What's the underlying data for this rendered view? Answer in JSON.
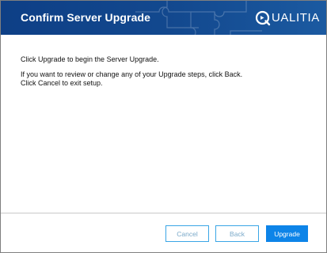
{
  "window": {
    "title": "Confirm Server Upgrade",
    "logo_text": "UALITIA",
    "logo_icon": "q-logo-icon",
    "header_color": "#13498f"
  },
  "content": {
    "line1": "Click Upgrade to begin the Server Upgrade.",
    "line2": "If you want to review or change any of your Upgrade steps, click Back.",
    "line3": "Click Cancel to exit setup."
  },
  "buttons": {
    "cancel_label": "Cancel",
    "back_label": "Back",
    "upgrade_label": "Upgrade",
    "primary_color": "#0d84e8"
  }
}
